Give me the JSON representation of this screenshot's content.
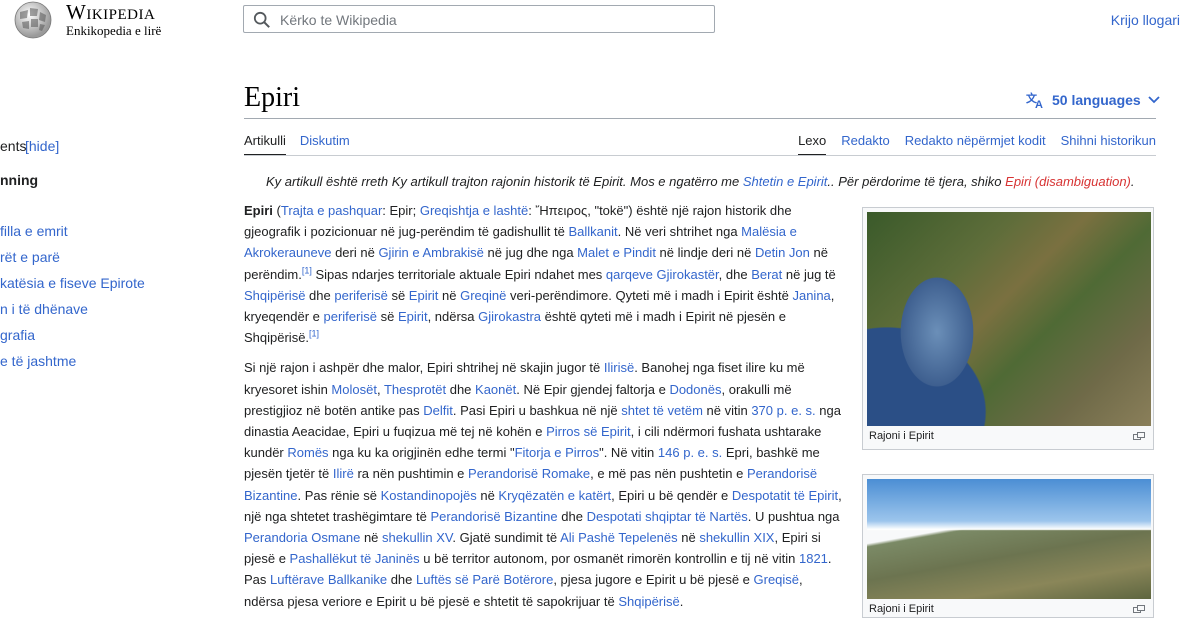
{
  "header": {
    "logo_word": "Wikipedia",
    "logo_tagline": "Enkikopedia e lirë",
    "search_placeholder": "Kërko te Wikipedia",
    "create_account": "Krijo llogari"
  },
  "toc": {
    "items": [
      "ents",
      "[hide]",
      "nning",
      "filla e emrit",
      "rët e parë",
      "katësia e fiseve Epirote",
      "n i të dhënave",
      "grafia",
      "e të jashtme"
    ]
  },
  "article": {
    "title": "Epiri",
    "languages": "50 languages",
    "tabs_left": [
      "Artikulli",
      "Diskutim"
    ],
    "tabs_right": [
      "Lexo",
      "Redakto",
      "Redakto nëpërmjet kodit",
      "Shihni historikun"
    ]
  },
  "hatnote": {
    "t1": "Ky artikull është rreth Ky artikull trajton rajonin historik të Epirit. Mos e ngatërro me ",
    "l1": "Shtetin e Epirit",
    "t2": ".. Për përdorime të tjera, shiko ",
    "l2": "Epiri (disambiguation)",
    "t3": "."
  },
  "p1": [
    [
      "b",
      "Epiri"
    ],
    [
      "t",
      " ("
    ],
    [
      "a",
      "Trajta e pashquar"
    ],
    [
      "t",
      ": Epir; "
    ],
    [
      "a",
      "Greqishtja e lashtë"
    ],
    [
      "t",
      ": Ἤπειρος, \"tokë\") është një rajon historik dhe gjeografik i pozicionuar në jug-perëndim të gadishullit të "
    ],
    [
      "a",
      "Ballkanit"
    ],
    [
      "t",
      ". Në veri shtrihet nga "
    ],
    [
      "a",
      "Malësia e Akrokerauneve"
    ],
    [
      "t",
      " deri në "
    ],
    [
      "a",
      "Gjirin e Ambrakisë"
    ],
    [
      "t",
      " në jug dhe nga "
    ],
    [
      "a",
      "Malet e Pindit"
    ],
    [
      "t",
      " në lindje deri në "
    ],
    [
      "a",
      "Detin Jon"
    ],
    [
      "t",
      " në perëndim."
    ],
    [
      "s",
      "[1]"
    ],
    [
      "t",
      " Sipas ndarjes territoriale aktuale Epiri ndahet mes "
    ],
    [
      "a",
      "qarqeve Gjirokastër"
    ],
    [
      "t",
      ", dhe "
    ],
    [
      "a",
      "Berat"
    ],
    [
      "t",
      " në jug të "
    ],
    [
      "a",
      "Shqipërisë"
    ],
    [
      "t",
      " dhe "
    ],
    [
      "a",
      "periferisë"
    ],
    [
      "t",
      " së "
    ],
    [
      "a",
      "Epirit"
    ],
    [
      "t",
      " në "
    ],
    [
      "a",
      "Greqinë"
    ],
    [
      "t",
      " veri-perëndimore. Qyteti më i madh i Epirit është "
    ],
    [
      "a",
      "Janina"
    ],
    [
      "t",
      ", kryeqendër e "
    ],
    [
      "a",
      "periferisë"
    ],
    [
      "t",
      " së "
    ],
    [
      "a",
      "Epirit"
    ],
    [
      "t",
      ", ndërsa "
    ],
    [
      "a",
      "Gjirokastra"
    ],
    [
      "t",
      " është qyteti më i madh i Epirit në pjesën e Shqipërisë."
    ],
    [
      "s",
      "[1]"
    ]
  ],
  "p2": [
    [
      "t",
      "Si një rajon i ashpër dhe malor, Epiri shtrihej në skajin jugor të "
    ],
    [
      "a",
      "Ilirisë"
    ],
    [
      "t",
      ". Banohej nga fiset ilire ku më kryesoret ishin "
    ],
    [
      "a",
      "Molosët"
    ],
    [
      "t",
      ", "
    ],
    [
      "a",
      "Thesprotët"
    ],
    [
      "t",
      " dhe "
    ],
    [
      "a",
      "Kaonët"
    ],
    [
      "t",
      ". Në Epir gjendej faltorja e "
    ],
    [
      "a",
      "Dodonës"
    ],
    [
      "t",
      ", orakulli më prestigjioz në botën antike pas "
    ],
    [
      "a",
      "Delfit"
    ],
    [
      "t",
      ". Pasi Epiri u bashkua në një "
    ],
    [
      "a",
      "shtet të vetëm"
    ],
    [
      "t",
      " në vitin "
    ],
    [
      "a",
      "370 p. e. s."
    ],
    [
      "t",
      " nga dinastia Aeacidae, Epiri u fuqizua më tej në kohën e "
    ],
    [
      "a",
      "Pirros së Epirit"
    ],
    [
      "t",
      ", i cili ndërmori fushata ushtarake kundër "
    ],
    [
      "a",
      "Romës"
    ],
    [
      "t",
      " nga ku ka origjinën edhe termi \""
    ],
    [
      "a",
      "Fitorja e Pirros"
    ],
    [
      "t",
      "\". Në vitin "
    ],
    [
      "a",
      "146 p. e. s."
    ],
    [
      "t",
      " Epri, bashkë me pjesën tjetër të "
    ],
    [
      "a",
      "Ilirë"
    ],
    [
      "t",
      " ra nën pushtimin e "
    ],
    [
      "a",
      "Perandorisë Romake"
    ],
    [
      "t",
      ", e më pas nën pushtetin e "
    ],
    [
      "a",
      "Perandorisë Bizantine"
    ],
    [
      "t",
      ". Pas rënie së "
    ],
    [
      "a",
      "Kostandinopojës"
    ],
    [
      "t",
      " në "
    ],
    [
      "a",
      "Kryqëzatën e katërt"
    ],
    [
      "t",
      ", Epiri u bë qendër e "
    ],
    [
      "a",
      "Despotatit të Epirit"
    ],
    [
      "t",
      ", një nga shtetet trashëgimtare të "
    ],
    [
      "a",
      "Perandorisë Bizantine"
    ],
    [
      "t",
      " dhe "
    ],
    [
      "a",
      "Despotati shqiptar të Nartës"
    ],
    [
      "t",
      ". U pushtua nga "
    ],
    [
      "a",
      "Perandoria Osmane"
    ],
    [
      "t",
      " në "
    ],
    [
      "a",
      "shekullin XV"
    ],
    [
      "t",
      ". Gjatë sundimit të "
    ],
    [
      "a",
      "Ali Pashë Tepelenës"
    ],
    [
      "t",
      " në "
    ],
    [
      "a",
      "shekullin XIX"
    ],
    [
      "t",
      ", Epiri si pjesë e "
    ],
    [
      "a",
      "Pashallëkut të Janinës"
    ],
    [
      "t",
      " u bë territor autonom, por osmanët rimorën kontrollin e tij në vitin "
    ],
    [
      "a",
      "1821"
    ],
    [
      "t",
      ". Pas "
    ],
    [
      "a",
      "Luftërave Ballkanike"
    ],
    [
      "t",
      " dhe "
    ],
    [
      "a",
      "Luftës së Parë Botërore"
    ],
    [
      "t",
      ", pjesa jugore e Epirit u bë pjesë e "
    ],
    [
      "a",
      "Greqisë"
    ],
    [
      "t",
      ", ndërsa pjesa veriore e Epirit u bë pjesë e shtetit të sapokrijuar të "
    ],
    [
      "a",
      "Shqipërisë"
    ],
    [
      "t",
      "."
    ]
  ],
  "figures": [
    {
      "caption": "Rajoni i Epirit"
    },
    {
      "caption": "Rajoni i Epirit"
    }
  ]
}
